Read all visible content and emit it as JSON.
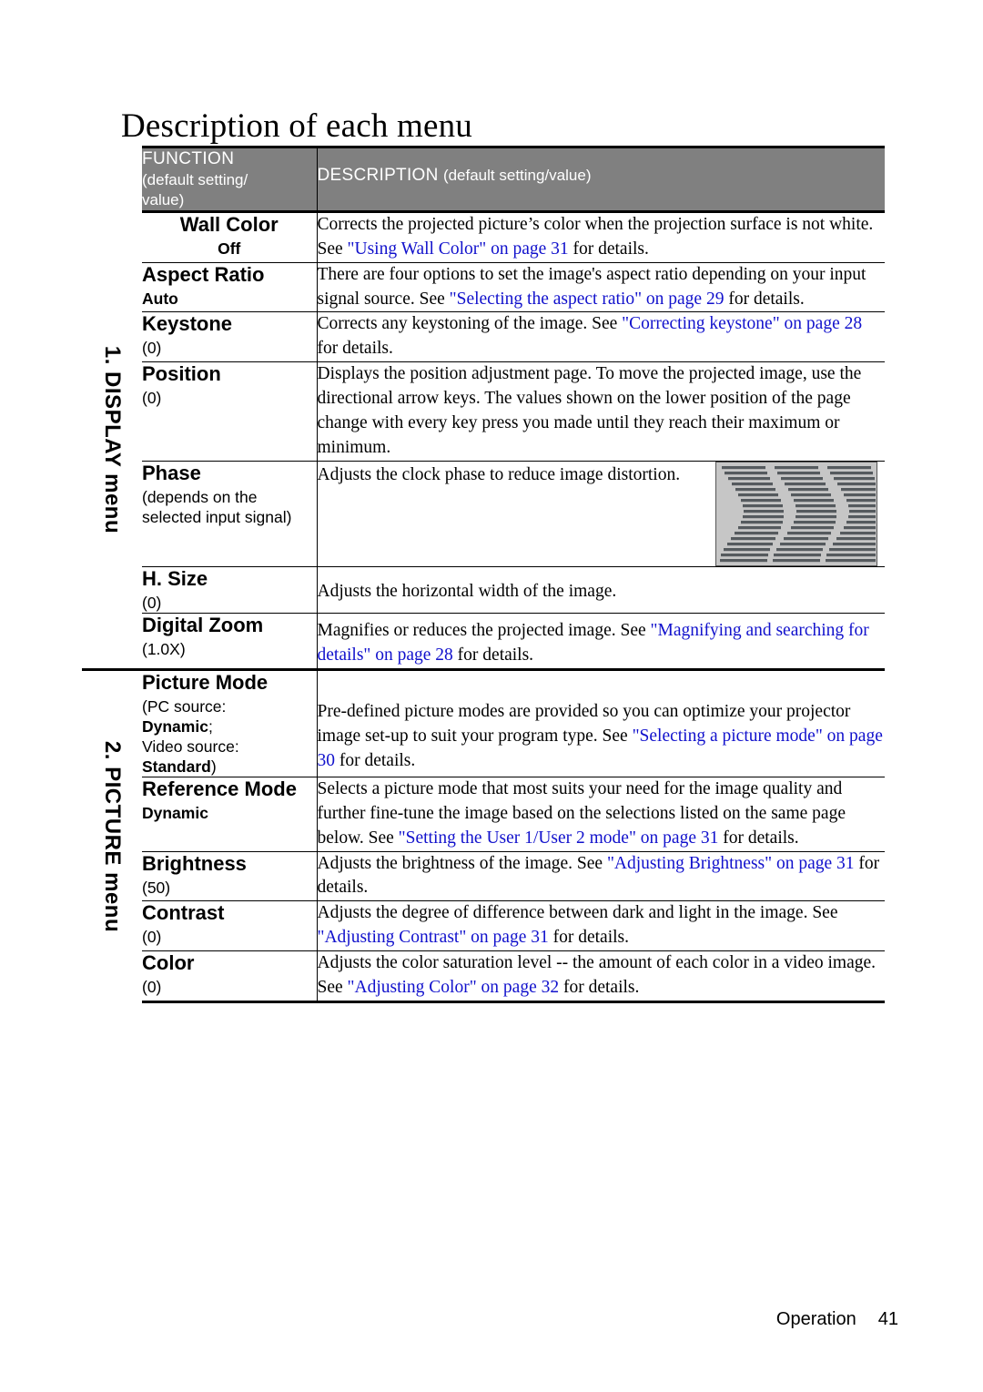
{
  "page": {
    "title": "Description of each menu",
    "footer_label": "Operation",
    "footer_page": "41",
    "link_color": "#1111cc",
    "header_bg": "#808080"
  },
  "table": {
    "header": {
      "function_title": "FUNCTION",
      "function_sub": "(default setting/ value)",
      "function_sub_line1": "(default setting/",
      "function_sub_line2": "value)",
      "description_title": "DESCRIPTION",
      "description_sub": "(default setting/value)"
    },
    "sections": [
      {
        "side_label": "1. DISPLAY menu",
        "rows": [
          {
            "name": "Wall Color",
            "default": "(Off)",
            "default_bold": "Off",
            "desc_plain_1": "Corrects the projected picture’s color when the projection surface is not white. See ",
            "desc_link_1": "\"Using Wall Color\" on page 31",
            "desc_plain_2": " for details."
          },
          {
            "name": "Aspect Ratio",
            "default": "(Auto)",
            "default_bold": "Auto",
            "desc_plain_1": "There are four options to set the image's aspect ratio depending on your input signal source. See ",
            "desc_link_1": "\"Selecting the aspect ratio\" on page 29",
            "desc_plain_2": " for details."
          },
          {
            "name": "Keystone",
            "default": "(0)",
            "desc_plain_1": "Corrects any keystoning of the image. See ",
            "desc_link_1": "\"Correcting keystone\" on page 28",
            "desc_plain_2": " for details."
          },
          {
            "name": "Position",
            "default": "(0)",
            "desc_plain_1": "Displays the position adjustment page. To move the projected image, use the directional arrow keys. The values shown on the lower position of the page change with every key press you made until they reach their maximum or minimum.",
            "desc_link_1": "",
            "desc_plain_2": ""
          },
          {
            "name": "Phase",
            "default": "(depends on the selected input signal)",
            "desc_plain_1": "Adjusts the clock phase to reduce image distortion.",
            "desc_link_1": "",
            "desc_plain_2": "",
            "figure": "phase-waveform-illustration"
          },
          {
            "name": "H. Size",
            "default": "(0)",
            "desc_plain_1": "Adjusts the horizontal width of the image.",
            "desc_link_1": "",
            "desc_plain_2": ""
          },
          {
            "name": "Digital Zoom",
            "default": "(1.0X)",
            "desc_plain_1": "Magnifies or reduces the projected image. See ",
            "desc_link_1": "\"Magnifying and searching for details\" on page 28",
            "desc_plain_2": " for details."
          }
        ]
      },
      {
        "side_label": "2. PICTURE menu",
        "rows": [
          {
            "name": "Picture Mode",
            "default_pc_label": "(PC source:",
            "default_pc_value": "Dynamic",
            "default_pc_semi": ";",
            "default_video_label": "Video source:",
            "default_video_value": "Standard",
            "default_video_close": ")",
            "desc_plain_1": "Pre-defined picture modes are provided so you can optimize your projector image set-up to suit your program type. See ",
            "desc_link_1": "\"Selecting a picture mode\" on page 30",
            "desc_plain_2": " for details."
          },
          {
            "name": "Reference Mode",
            "default": "(Dynamic)",
            "default_bold": "Dynamic",
            "desc_plain_1": "Selects a picture mode that most suits your need for the image quality and further fine-tune the image based on the selections listed on the same page below. See ",
            "desc_link_1": "\"Setting the User 1/User 2 mode\" on page 31",
            "desc_plain_2": " for details."
          },
          {
            "name": "Brightness",
            "default": "(50)",
            "desc_plain_1": "Adjusts the brightness of the image. See ",
            "desc_link_1": "\"Adjusting Brightness\" on page 31",
            "desc_plain_2": " for details."
          },
          {
            "name": "Contrast",
            "default": "(0)",
            "desc_plain_1": "Adjusts the degree of difference between dark and light in the image. See ",
            "desc_link_1": "\"Adjusting Contrast\" on page 31",
            "desc_plain_2": " for details."
          },
          {
            "name": "Color",
            "default": "(0)",
            "desc_plain_1": "Adjusts the color saturation level -- the amount of each color in a video image. See ",
            "desc_link_1": "\"Adjusting Color\" on page 32",
            "desc_plain_2": " for details."
          }
        ]
      }
    ]
  }
}
